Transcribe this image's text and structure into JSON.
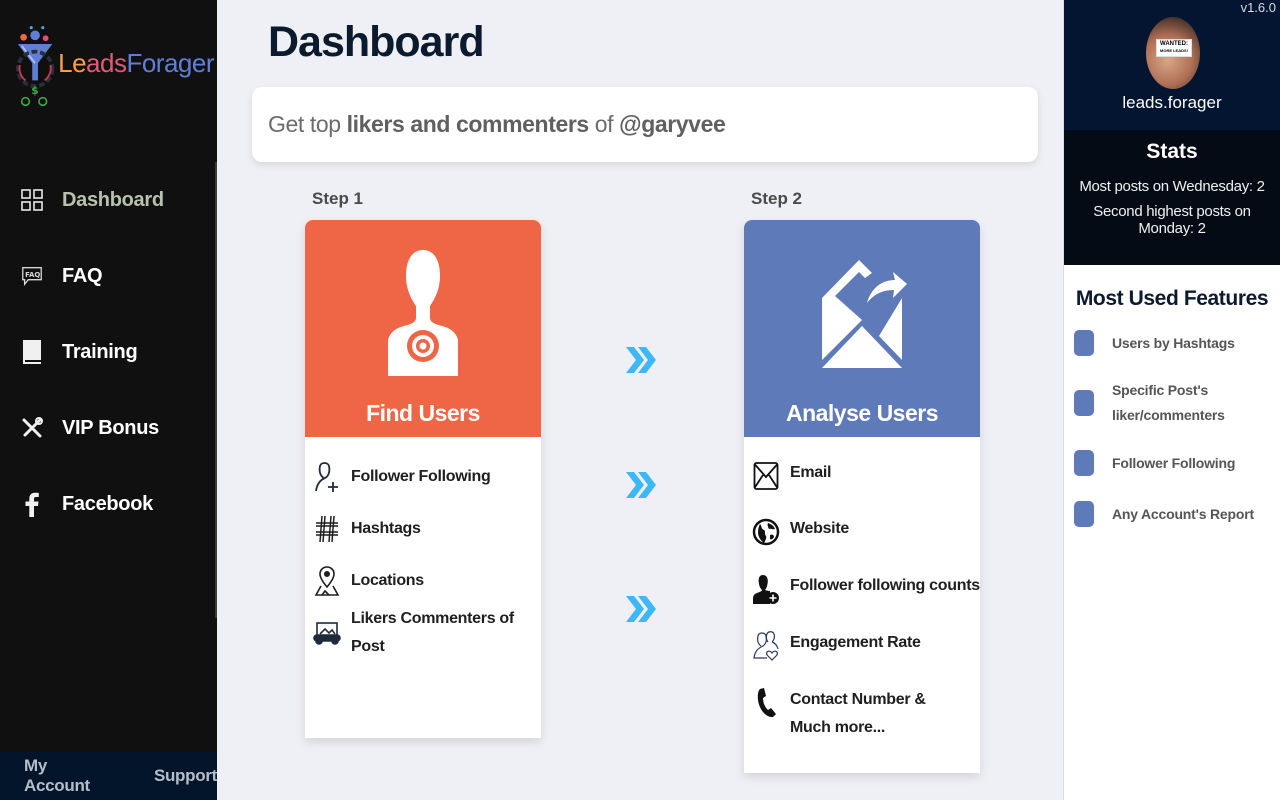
{
  "app": {
    "logo_text_part1": "Le",
    "logo_text_part2": "ads",
    "logo_text_part3": "Forager",
    "version": "v1.6.0"
  },
  "sidebar": {
    "items": [
      {
        "label": "Dashboard",
        "icon": "grid-icon",
        "active": true
      },
      {
        "label": "FAQ",
        "icon": "faq-chat-icon",
        "active": false
      },
      {
        "label": "Training",
        "icon": "book-icon",
        "active": false
      },
      {
        "label": "VIP Bonus",
        "icon": "tools-icon",
        "active": false
      },
      {
        "label": "Facebook",
        "icon": "facebook-icon",
        "active": false
      }
    ],
    "footer": {
      "my_account": "My Account",
      "support": "Support"
    }
  },
  "main": {
    "title": "Dashboard",
    "prompt": {
      "prefix": "Get top ",
      "bold1": "likers and commenters",
      "middle": " of ",
      "handle": "@garyvee"
    },
    "steps": [
      {
        "step_label": "Step 1",
        "title": "Find Users",
        "color": "#ef6647",
        "hero_icon": "target-person-icon",
        "items": [
          {
            "label": "Follower Following",
            "icon": "user-add-icon"
          },
          {
            "label": "Hashtags",
            "icon": "hashtag-icon"
          },
          {
            "label": "Locations",
            "icon": "map-pin-icon"
          },
          {
            "label": "Likers Commenters of Post",
            "icon": "image-post-icon"
          }
        ]
      },
      {
        "step_label": "Step 2",
        "title": "Analyse Users",
        "color": "#5f7ab8",
        "hero_icon": "open-envelope-arrow-icon",
        "items": [
          {
            "label": "Email",
            "icon": "envelope-icon"
          },
          {
            "label": "Website",
            "icon": "globe-icon"
          },
          {
            "label": "Follower following counts",
            "icon": "user-plus-solid-icon"
          },
          {
            "label": "Engagement Rate",
            "icon": "users-heart-icon"
          },
          {
            "label": "Contact Number & Much more...",
            "icon": "phone-icon"
          }
        ]
      }
    ],
    "arrow_color": "#3db8f5"
  },
  "right_panel": {
    "username": "leads.forager",
    "avatar_sign_line1": "WANTED:",
    "avatar_sign_line2": "MORE LEADS!",
    "stats": {
      "title": "Stats",
      "lines": [
        "Most posts on Wednesday: 2",
        "Second highest posts on Monday: 2"
      ]
    },
    "features": {
      "title": "Most Used Features",
      "items": [
        "Users by Hashtags",
        "Specific Post's liker/commenters",
        "Follower Following",
        "Any Account's Report"
      ]
    }
  }
}
